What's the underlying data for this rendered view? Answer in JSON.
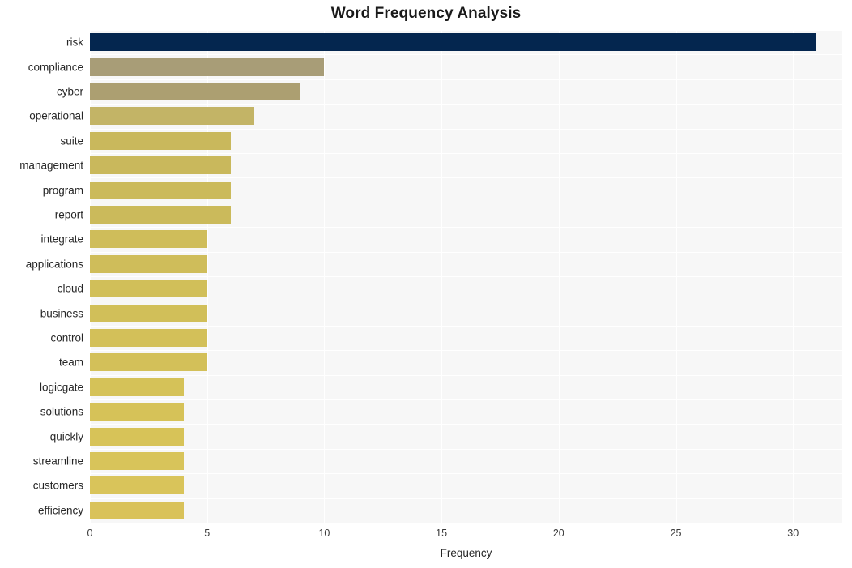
{
  "chart_data": {
    "type": "bar",
    "orientation": "horizontal",
    "title": "Word Frequency Analysis",
    "xlabel": "Frequency",
    "ylabel": "",
    "categories": [
      "risk",
      "compliance",
      "cyber",
      "operational",
      "suite",
      "management",
      "program",
      "report",
      "integrate",
      "applications",
      "cloud",
      "business",
      "control",
      "team",
      "logicgate",
      "solutions",
      "quickly",
      "streamline",
      "customers",
      "efficiency"
    ],
    "values": [
      31,
      10,
      9,
      7,
      6,
      6,
      6,
      6,
      5,
      5,
      5,
      5,
      5,
      5,
      4,
      4,
      4,
      4,
      4,
      4
    ],
    "bar_colors": [
      "#04264f",
      "#a89d77",
      "#ac9f71",
      "#c3b466",
      "#c9b85c",
      "#c9b85c",
      "#cbba5b",
      "#cbba5b",
      "#cfbd5a",
      "#cfbd5a",
      "#d1bf59",
      "#d1bf59",
      "#d3c059",
      "#d3c059",
      "#d5c258",
      "#d6c258",
      "#d7c358",
      "#d8c45a",
      "#d9c45a",
      "#d9c25a"
    ],
    "xlim": [
      0,
      32.1
    ],
    "xticks": [
      0,
      5,
      10,
      15,
      20,
      25,
      30
    ],
    "xticklabels": [
      "0",
      "5",
      "10",
      "15",
      "20",
      "25",
      "30"
    ],
    "grid": true,
    "grid_color": "#ffffff",
    "plot_background": "#f7f7f7",
    "figure_background": "#ffffff",
    "legend": null
  }
}
